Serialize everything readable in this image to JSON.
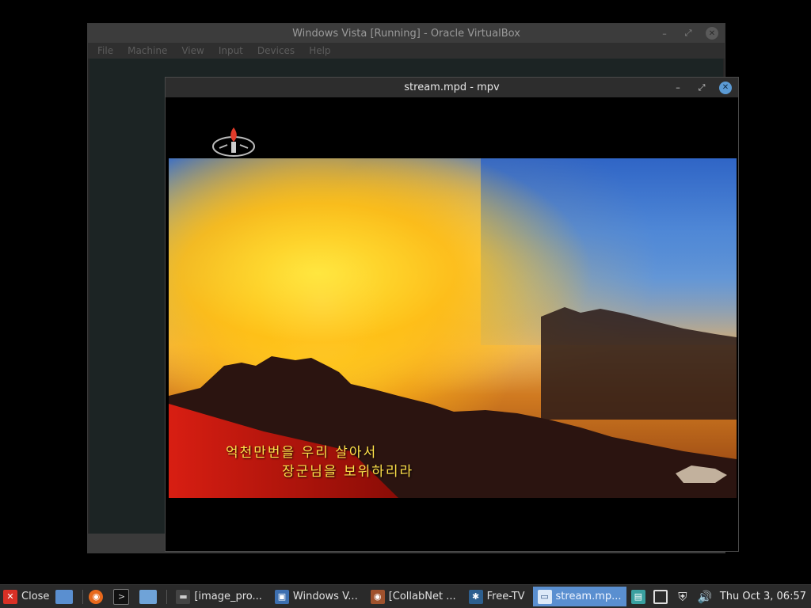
{
  "vbox": {
    "title": "Windows Vista [Running] - Oracle VirtualBox",
    "menu": [
      "File",
      "Machine",
      "View",
      "Input",
      "Devices",
      "Help"
    ]
  },
  "mpv": {
    "title": "stream.mpd - mpv",
    "subtitles": [
      "억천만번을 우리 살아서",
      "장군님을 보위하리라"
    ]
  },
  "window_controls": {
    "minimize": "–",
    "maximize": "⤢",
    "close": "✕"
  },
  "taskbar": {
    "close_label": "Close",
    "tasks": [
      {
        "label": "[image_pro...",
        "icon": "terminal-icon"
      },
      {
        "label": "Windows V...",
        "icon": "virtualbox-icon"
      },
      {
        "label": "[CollabNet ...",
        "icon": "firefox-icon"
      },
      {
        "label": "Free-TV",
        "icon": "app-icon"
      },
      {
        "label": "stream.mp...",
        "icon": "mpv-icon",
        "active": true
      }
    ],
    "clock": "Thu Oct  3, 06:57"
  },
  "colors": {
    "accent": "#5a8fd0",
    "close_red": "#d93025",
    "subtitle_yellow": "#ffe14a"
  }
}
